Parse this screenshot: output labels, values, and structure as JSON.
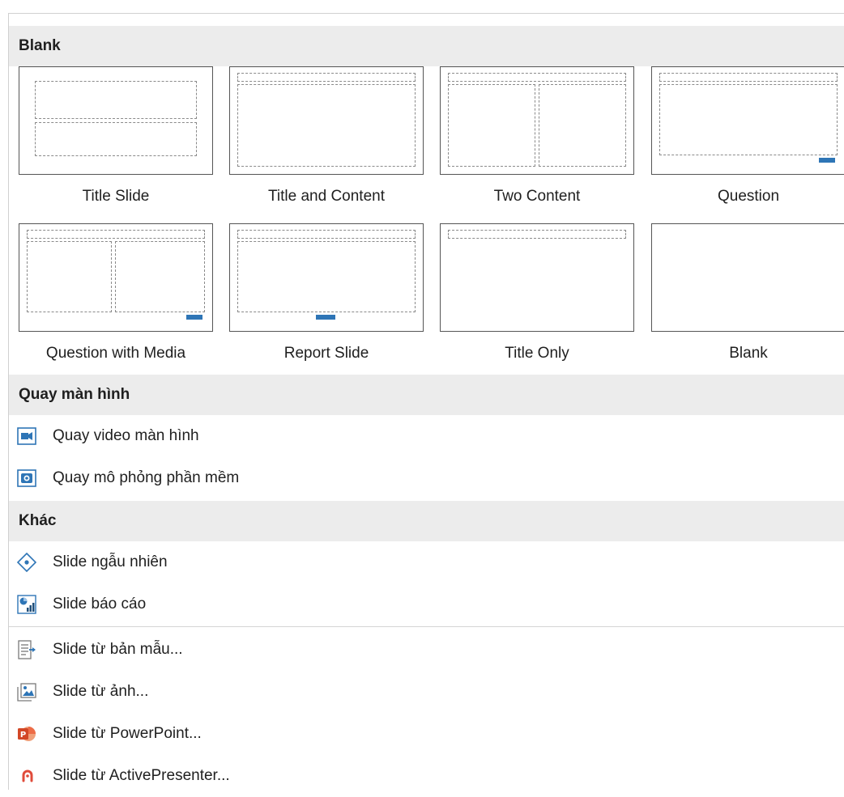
{
  "sections": {
    "blank": {
      "title": "Blank"
    },
    "screen": {
      "title": "Quay màn hình"
    },
    "other": {
      "title": "Khác"
    }
  },
  "layouts": [
    {
      "label": "Title Slide"
    },
    {
      "label": "Title and Content"
    },
    {
      "label": "Two Content"
    },
    {
      "label": "Question"
    },
    {
      "label": "Question with Media"
    },
    {
      "label": "Report Slide"
    },
    {
      "label": "Title Only"
    },
    {
      "label": "Blank"
    }
  ],
  "screen_items": [
    {
      "label": "Quay video màn hình",
      "icon": "video-camera-icon"
    },
    {
      "label": "Quay mô phỏng phần mềm",
      "icon": "camera-icon"
    }
  ],
  "other_items": [
    {
      "label": "Slide ngẫu nhiên",
      "icon": "random-diamond-icon"
    },
    {
      "label": "Slide báo cáo",
      "icon": "report-chart-icon"
    }
  ],
  "import_items": [
    {
      "label": "Slide từ bản mẫu...",
      "icon": "template-import-icon"
    },
    {
      "label": "Slide từ ảnh...",
      "icon": "image-icon"
    },
    {
      "label": "Slide từ PowerPoint...",
      "icon": "powerpoint-icon"
    },
    {
      "label": "Slide từ ActivePresenter...",
      "icon": "activepresenter-icon"
    }
  ],
  "colors": {
    "accent": "#2e75b6",
    "header_bg": "#ececec",
    "powerpoint": "#d24726",
    "activepresenter": "#e04b3a"
  }
}
